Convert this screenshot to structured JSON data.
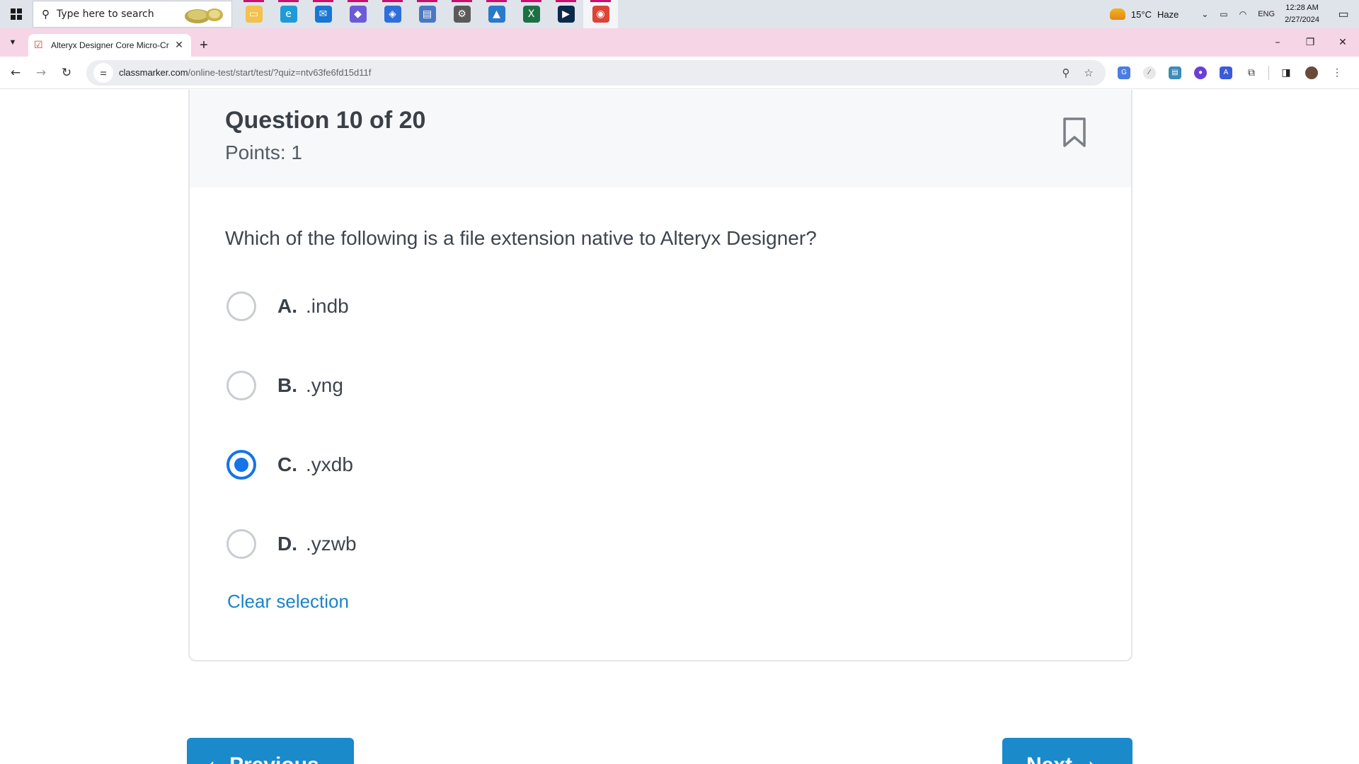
{
  "taskbar": {
    "search_placeholder": "Type here to search",
    "apps": [
      {
        "name": "file-explorer",
        "color": "#f2c14e",
        "glyph": "▭",
        "running": true,
        "active": false
      },
      {
        "name": "edge",
        "color": "#1f9ad6",
        "glyph": "e",
        "running": true,
        "active": false
      },
      {
        "name": "mail",
        "color": "#1976d2",
        "glyph": "✉",
        "running": true,
        "active": false
      },
      {
        "name": "copilot",
        "color": "#6b5bd6",
        "glyph": "◆",
        "running": true,
        "active": false
      },
      {
        "name": "app-blue",
        "color": "#2f6fd9",
        "glyph": "◈",
        "running": true,
        "active": false
      },
      {
        "name": "document",
        "color": "#4a78c2",
        "glyph": "▤",
        "running": true,
        "active": false
      },
      {
        "name": "settings",
        "color": "#5a5a5a",
        "glyph": "⚙",
        "running": true,
        "active": false
      },
      {
        "name": "photos",
        "color": "#2b79c9",
        "glyph": "▲",
        "running": true,
        "active": false
      },
      {
        "name": "excel",
        "color": "#1d7044",
        "glyph": "X",
        "running": true,
        "active": false
      },
      {
        "name": "terminal",
        "color": "#0b2a4a",
        "glyph": "▶",
        "running": true,
        "active": false
      },
      {
        "name": "chrome",
        "color": "#db4437",
        "glyph": "◉",
        "running": true,
        "active": true
      }
    ],
    "weather_temp": "15°C",
    "weather_cond": "Haze",
    "lang": "ENG",
    "time": "12:28 AM",
    "date": "2/27/2024"
  },
  "browser": {
    "tab_title": "Alteryx Designer Core Micro-Cr",
    "url_host": "classmarker.com",
    "url_path": "/online-test/start/test/?quiz=ntv63fe6fd15d11f"
  },
  "question": {
    "title": "Question 10 of 20",
    "points": "Points: 1",
    "text": "Which of the following is a file extension native to Alteryx Designer?",
    "options": [
      {
        "letter": "A.",
        "text": ".indb",
        "selected": false
      },
      {
        "letter": "B.",
        "text": ".yng",
        "selected": false
      },
      {
        "letter": "C.",
        "text": ".yxdb",
        "selected": true
      },
      {
        "letter": "D.",
        "text": ".yzwb",
        "selected": false
      }
    ],
    "clear_label": "Clear selection"
  },
  "nav": {
    "prev_label": "Previous",
    "next_label": "Next"
  },
  "colors": {
    "accent": "#1474e8",
    "button": "#1a8acb",
    "link": "#1a84c8",
    "tabstrip": "#f6d5e6"
  }
}
